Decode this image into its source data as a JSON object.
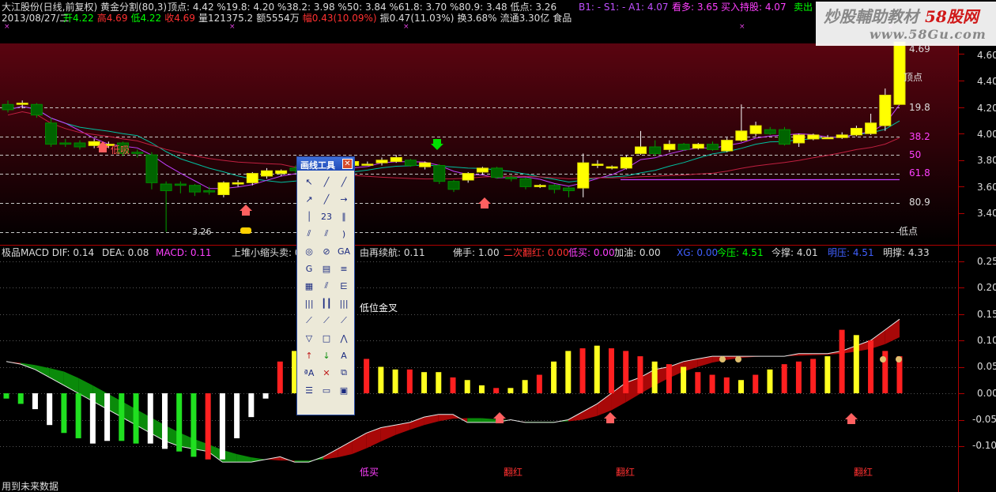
{
  "header": {
    "stock": "大江股份(日线,前复权) 黄金分割(80,3)",
    "fib_summary": "顶点: 4.42  %19.8: 4.20  %38.2: 3.98  %50: 3.84  %61.8: 3.70  %80.9: 3.48  低点: 3.26",
    "indicators_right": [
      {
        "text": "B1: -  S1: -  A1: 4.07",
        "color": "#c050ff"
      },
      {
        "text": "看多: 3.65",
        "color": "#ff40ff"
      },
      {
        "text": "买入持股: 4.07",
        "color": "#ff40ff"
      },
      {
        "text": "卖出",
        "color": "#00ff00"
      }
    ],
    "date": "2013/08/27/二",
    "quote": [
      {
        "text": "开4.22",
        "color": "#00ff00"
      },
      {
        "text": "高4.69",
        "color": "#ff3030"
      },
      {
        "text": "低4.22",
        "color": "#00ff00"
      },
      {
        "text": "收4.69",
        "color": "#ff3030"
      },
      {
        "text": "量121375.2",
        "color": "#dddddd"
      },
      {
        "text": "额5554万",
        "color": "#dddddd"
      },
      {
        "text": "幅0.43(10.09%)",
        "color": "#ff3030"
      },
      {
        "text": "振0.47(11.03%)",
        "color": "#dddddd"
      },
      {
        "text": "换3.68%",
        "color": "#dddddd"
      },
      {
        "text": "流通3.30亿",
        "color": "#dddddd"
      },
      {
        "text": "食品",
        "color": "#dddddd"
      }
    ]
  },
  "watermark": {
    "text1": "炒股輔助教材",
    "text2": "58股网",
    "url": "www.58Gu.com"
  },
  "price_axis": [
    "4.60",
    "4.40",
    "4.20",
    "4.00",
    "3.80",
    "3.60",
    "3.40"
  ],
  "fib_labels": [
    {
      "text": "4.69",
      "color": "#dddddd"
    },
    {
      "text": "顶点",
      "color": "#dddddd"
    },
    {
      "text": "19.8",
      "color": "#dddddd"
    },
    {
      "text": "38.2",
      "color": "#ff40ff"
    },
    {
      "text": "50",
      "color": "#ff40ff"
    },
    {
      "text": "61.8",
      "color": "#ff40ff"
    },
    {
      "text": "80.9",
      "color": "#dddddd"
    },
    {
      "text": "低点",
      "color": "#dddddd"
    }
  ],
  "annotations": {
    "low_price": "3.26",
    "buy_point": "低吸",
    "golden_cross": "低位金叉"
  },
  "macd_header": [
    {
      "text": "极品MACD  DIF: 0.14",
      "color": "#dddddd"
    },
    {
      "text": "DEA: 0.08",
      "color": "#dddddd"
    },
    {
      "text": "MACD: 0.11",
      "color": "#ff40ff"
    },
    {
      "text": "上堆小缩头卖: 0",
      "color": "#dddddd"
    },
    {
      "text": "由再续航: 0.11",
      "color": "#dddddd"
    },
    {
      "text": "佛手: 1.00",
      "color": "#dddddd"
    },
    {
      "text": "二次翻红: 0.00",
      "color": "#ff3030"
    },
    {
      "text": "低买: 0.00",
      "color": "#ff40ff"
    },
    {
      "text": "加油: 0.00",
      "color": "#dddddd"
    },
    {
      "text": "XG: 0.00",
      "color": "#4060ff"
    },
    {
      "text": "今压: 4.51",
      "color": "#00ff00"
    },
    {
      "text": "今撑: 4.01",
      "color": "#dddddd"
    },
    {
      "text": "明压: 4.51",
      "color": "#4060ff"
    },
    {
      "text": "明撑: 4.33",
      "color": "#dddddd"
    }
  ],
  "macd_axis": [
    "0.25",
    "0.20",
    "0.15",
    "0.10",
    "0.05",
    "0.00",
    "-0.05",
    "-0.10"
  ],
  "macd_signals": [
    "低买",
    "翻红",
    "翻红",
    "翻红"
  ],
  "footer": "用到未来数据",
  "toolbar": {
    "title": "画线工具"
  }
}
